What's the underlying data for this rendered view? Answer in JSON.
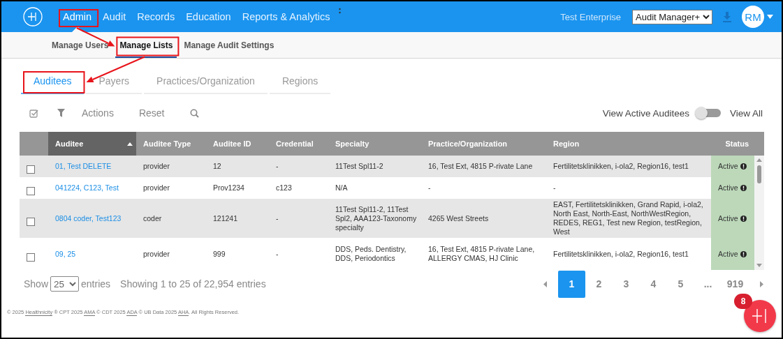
{
  "top_nav": {
    "items": [
      {
        "label": "Admin",
        "selected": true,
        "highlighted": true
      },
      {
        "label": "Audit",
        "selected": false,
        "highlighted": false
      },
      {
        "label": "Records",
        "selected": false,
        "highlighted": false
      },
      {
        "label": "Education",
        "selected": false,
        "highlighted": false
      },
      {
        "label": "Reports & Analytics",
        "selected": false,
        "highlighted": false
      }
    ],
    "enterprise": "Test Enterprise",
    "role_select": {
      "value": "Audit Manager+"
    },
    "avatar": "RM"
  },
  "sub_nav": [
    {
      "label": "Manage Users",
      "selected": false,
      "highlighted": false
    },
    {
      "label": "Manage Lists",
      "selected": true,
      "highlighted": true
    },
    {
      "label": "Manage Audit Settings",
      "selected": false,
      "highlighted": false
    }
  ],
  "tabs": [
    {
      "label": "Auditees",
      "selected": true,
      "highlighted": true
    },
    {
      "label": "Payers",
      "selected": false,
      "highlighted": false
    },
    {
      "label": "Practices/Organization",
      "selected": false,
      "highlighted": false
    },
    {
      "label": "Regions",
      "selected": false,
      "highlighted": false
    }
  ],
  "toolbar": {
    "actions": "Actions",
    "reset": "Reset"
  },
  "toggle": {
    "label": "View Active Auditees",
    "on": false,
    "other_label": "View All"
  },
  "table": {
    "columns": [
      {
        "label": "Auditee",
        "sorted": true
      },
      {
        "label": "Auditee Type",
        "sorted": false
      },
      {
        "label": "Auditee ID",
        "sorted": false
      },
      {
        "label": "Credential",
        "sorted": false
      },
      {
        "label": "Specialty",
        "sorted": false
      },
      {
        "label": "Practice/Organization",
        "sorted": false
      },
      {
        "label": "Region",
        "sorted": false
      },
      {
        "label": "Status",
        "sorted": false
      }
    ],
    "rows": [
      {
        "checked": false,
        "auditee": "01, Test DELETE",
        "type": "provider",
        "id": "12",
        "credential": "-",
        "specialty": "11Test Spl11-2",
        "practice": "16, Test Ext, 4815 P-rivate Lane",
        "region": "Fertilitetsklinikken, i-ola2, Region16, test1",
        "status": "Active"
      },
      {
        "checked": false,
        "auditee": "041224, C123, Test",
        "type": "provider",
        "id": "Prov1234",
        "credential": "c123",
        "specialty": "N/A",
        "practice": "-",
        "region": "-",
        "status": "Active"
      },
      {
        "checked": false,
        "auditee": "0804 coder, Test123",
        "type": "coder",
        "id": "121241",
        "credential": "-",
        "specialty": "11Test Spl11-2, 11Test Spl2, AAA123-Taxonomy specialty",
        "practice": "4265 West Streets",
        "region": "EAST, Fertilitetsklinikken, Grand Rapid, i-ola2, North East, North-East, NorthWestRegion, REDES, REG1, Test new Region, testRegion, West",
        "status": "Active"
      },
      {
        "checked": false,
        "auditee": "09, 25",
        "type": "provider",
        "id": "999",
        "credential": "-",
        "specialty": "DDS, Peds. Dentistry, DDS, Periodontics",
        "practice": "16, Test Ext, 4815 P-rivate Lane, ALLERGY CMAS, HJ Clinic",
        "region": "Fertilitetsklinikken, i-ola2, Region16, test1",
        "status": "Active"
      }
    ]
  },
  "page_size": {
    "show": "Show",
    "value": "25",
    "entries": "entries"
  },
  "summary": "Showing 1 to 25 of 22,954 entries",
  "pagination": [
    {
      "label": "1",
      "selected": true
    },
    {
      "label": "2",
      "selected": false
    },
    {
      "label": "3",
      "selected": false
    },
    {
      "label": "4",
      "selected": false
    },
    {
      "label": "5",
      "selected": false
    },
    {
      "label": "...",
      "selected": false
    },
    {
      "label": "919",
      "selected": false
    }
  ],
  "footer": [
    {
      "text": "© 2025 ",
      "link": false
    },
    {
      "text": "Healthnicity",
      "link": true
    },
    {
      "text": " ® CPT 2025 ",
      "link": false
    },
    {
      "text": "AMA",
      "link": true
    },
    {
      "text": " © CDT 2025 ",
      "link": false
    },
    {
      "text": "ADA",
      "link": true
    },
    {
      "text": " © UB Data 2025 ",
      "link": false
    },
    {
      "text": "AHA",
      "link": true
    },
    {
      "text": ". All Rights Reserved.",
      "link": false
    }
  ],
  "fab": {
    "badge": "8"
  }
}
